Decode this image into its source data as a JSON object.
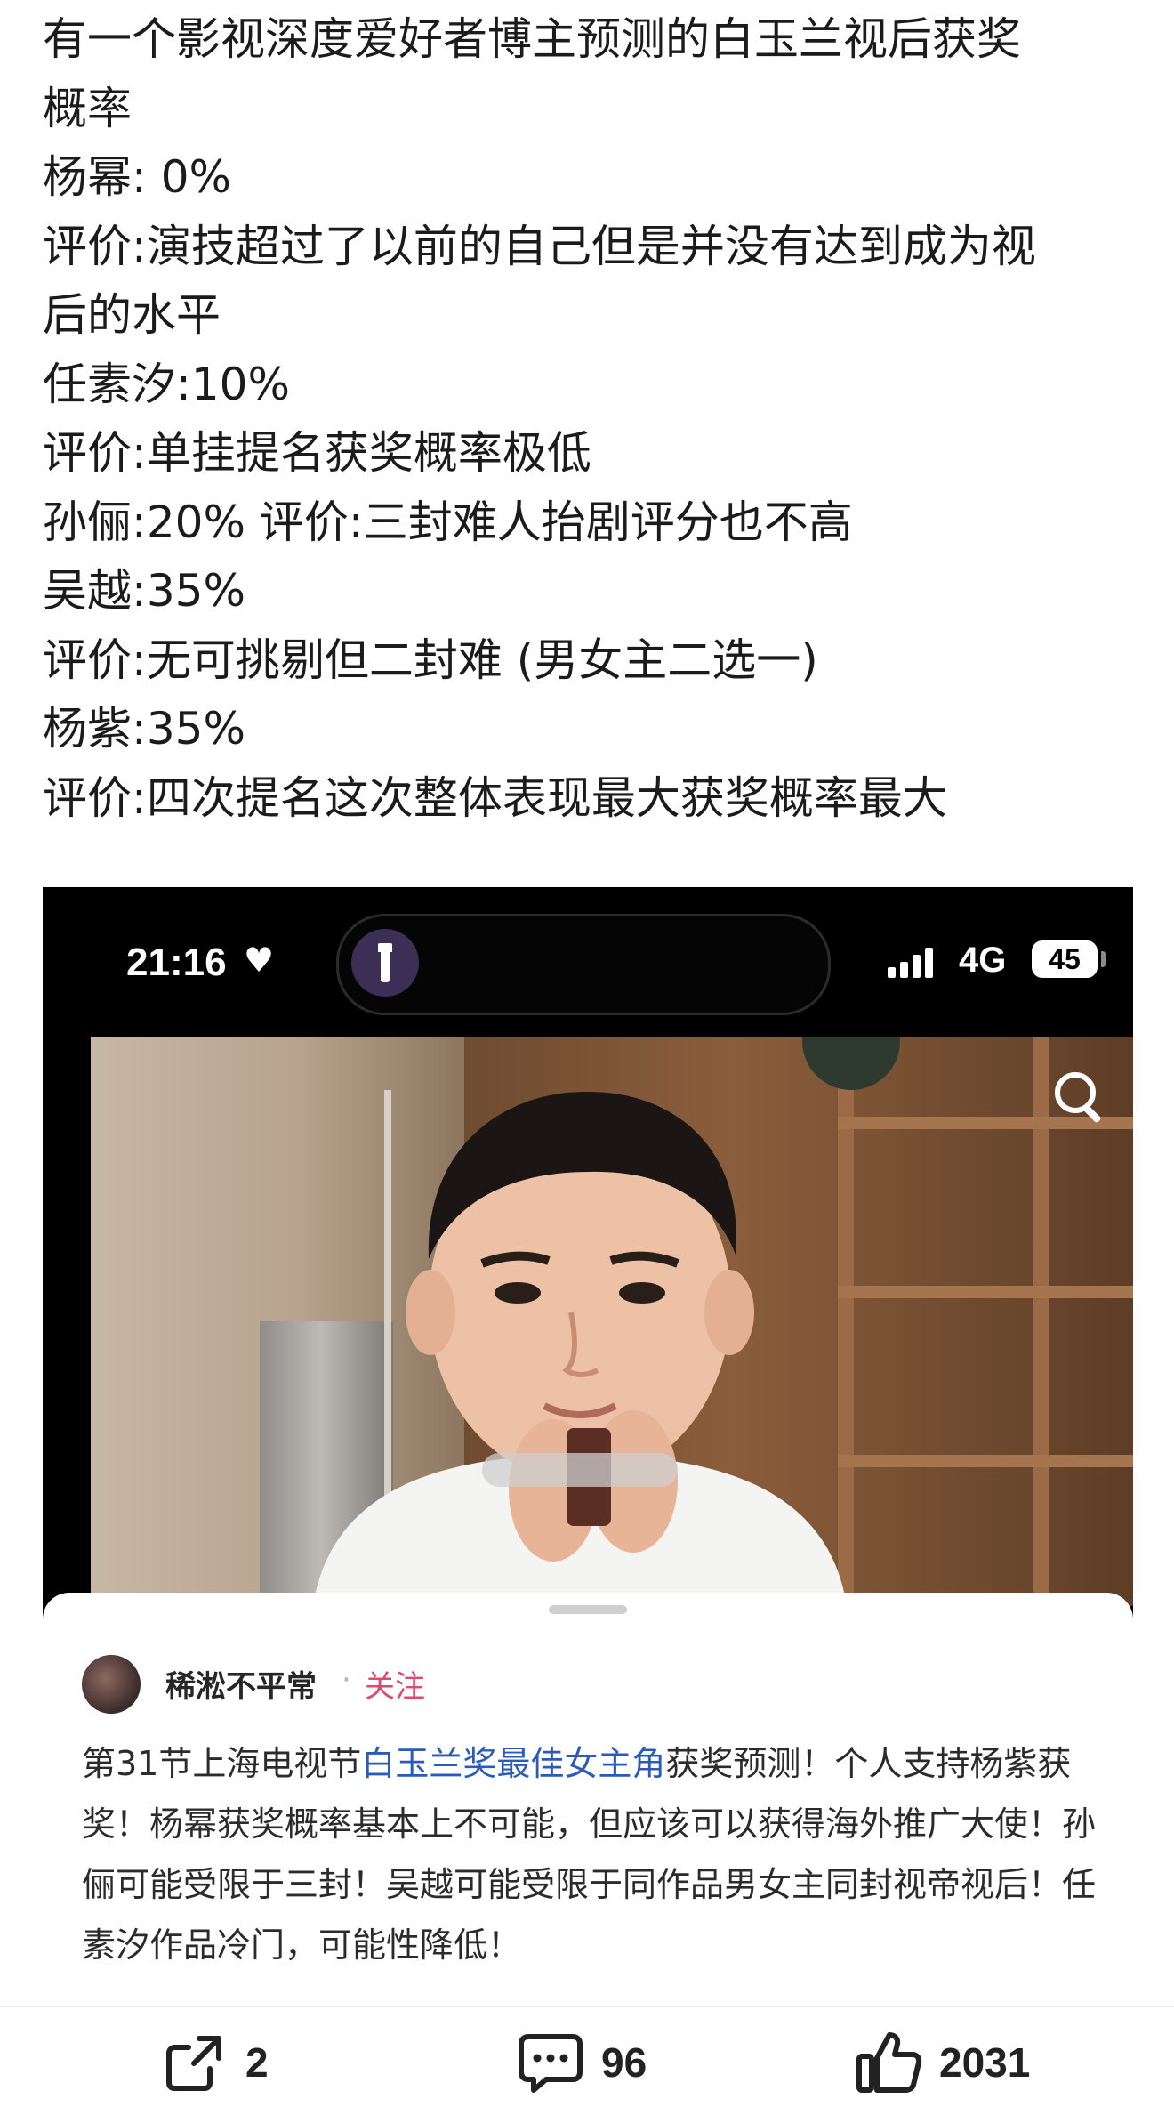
{
  "post": {
    "lines": [
      "有一个影视深度爱好者博主预测的白玉兰视后获奖",
      "概率",
      "杨幂: 0%",
      "评价:演技超过了以前的自己但是并没有达到成为视",
      "后的水平",
      "任素汐:10%",
      "评价:单挂提名获奖概率极低",
      "孙俪:20% 评价:三封难人抬剧评分也不高",
      "吴越:35%",
      "评价:无可挑剔但二封难 (男女主二选一)",
      "杨紫:35%",
      "评价:四次提名这次整体表现最大获奖概率最大"
    ]
  },
  "screenshot": {
    "status_bar": {
      "time": "21:16",
      "network": "4G",
      "battery": "45"
    },
    "author": {
      "name": "稀淞不平常",
      "separator": "·",
      "follow_label": "关注"
    },
    "caption": {
      "before": "第31节上海电视节",
      "highlight": "白玉兰奖最佳女主角",
      "after": "获奖预测！个人支持杨紫获奖！杨幂获奖概率基本上不可能，但应该可以获得海外推广大使！孙俪可能受限于三封！吴越可能受限于同作品男女主同封视帝视后！任素汐作品冷门，可能性降低！"
    }
  },
  "actions": {
    "share_count": "2",
    "comment_count": "96",
    "like_count": "2031"
  },
  "icons": {
    "share": "share-icon",
    "comment": "comment-icon",
    "like": "thumbs-up-icon",
    "search": "search-icon",
    "torch": "flashlight-icon",
    "heart": "heart-icon"
  }
}
